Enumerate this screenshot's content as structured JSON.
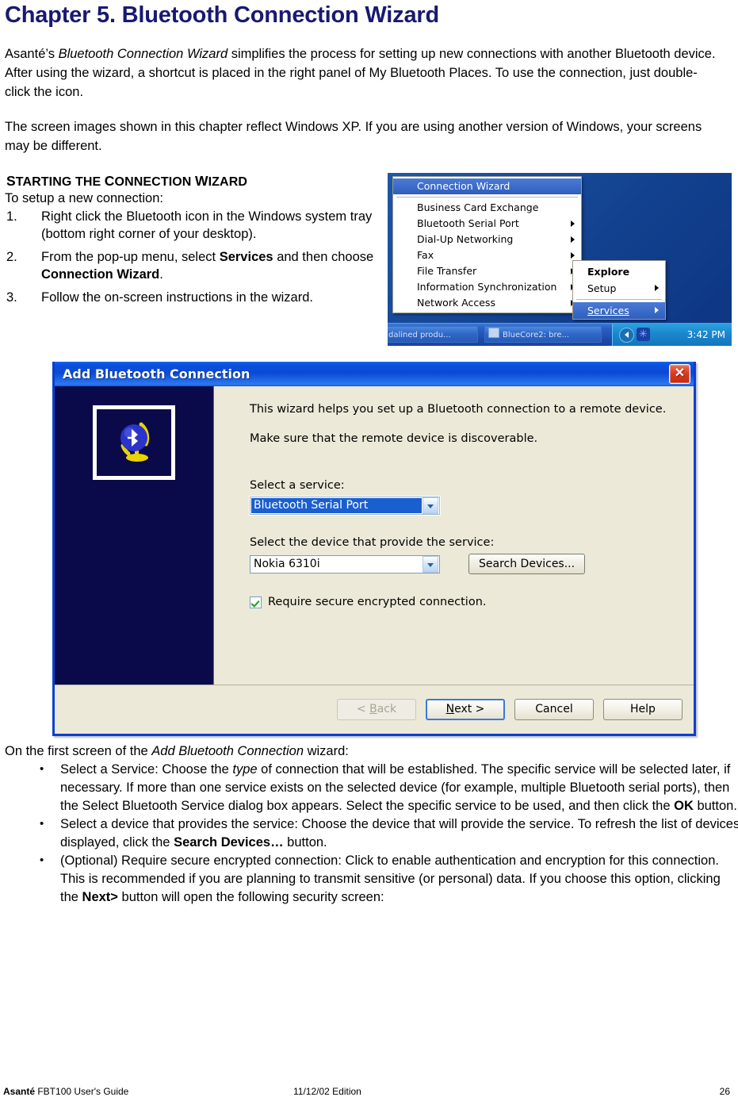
{
  "document": {
    "chapter_title": "Chapter 5. Bluetooth Connection Wizard",
    "paragraph_1_a": "Asanté’s ",
    "paragraph_1_em": "Bluetooth Connection Wizard",
    "paragraph_1_b": " simplifies the process for setting up new connections with another Bluetooth device. After using the wizard, a shortcut is placed in the right panel of My Bluetooth Places. To use the connection, just double-click the icon.",
    "paragraph_2": "The screen images shown in this chapter reflect Windows XP. If you are using another version of Windows, your screens may be different."
  },
  "section": {
    "heading_parts": [
      "S",
      "TARTING THE ",
      "C",
      "ONNECTION ",
      "W",
      "IZARD"
    ],
    "heading_text": "STARTING THE CONNECTION WIZARD",
    "intro": "To setup a new connection:",
    "steps": [
      {
        "num": "1.",
        "text": "Right click the Bluetooth icon in the Windows system tray (bottom right corner of your desktop)."
      },
      {
        "num": "2.",
        "pre": "From the pop-up menu, select ",
        "bold1": "Services",
        "mid": " and then choose ",
        "bold2": "Connection Wizard",
        "post": "."
      },
      {
        "num": "3.",
        "text": "Follow the on-screen instructions in the wizard."
      }
    ]
  },
  "tray_screenshot": {
    "context_menu": {
      "selected_item": "Connection Wizard",
      "items": [
        {
          "label": "Business Card Exchange",
          "submenu": false
        },
        {
          "label": "Bluetooth Serial Port",
          "submenu": true
        },
        {
          "label": "Dial-Up Networking",
          "submenu": true
        },
        {
          "label": "Fax",
          "submenu": true
        },
        {
          "label": "File Transfer",
          "submenu": true
        },
        {
          "label": "Information Synchronization",
          "submenu": true
        },
        {
          "label": "Network Access",
          "submenu": true
        }
      ]
    },
    "sub_menu": {
      "items": [
        {
          "label": "Explore",
          "bold": true,
          "submenu": false,
          "selected": false
        },
        {
          "label": "Setup",
          "bold": false,
          "submenu": true,
          "selected": false
        },
        {
          "label": "Services",
          "bold": false,
          "submenu": true,
          "selected": true
        }
      ]
    },
    "taskbar": {
      "button_1": "dalined produ...",
      "button_2": "BlueCore2: bre...",
      "clock": "3:42 PM"
    },
    "colors": {
      "menu_highlight": "#3465c4",
      "desktop": "#12418e",
      "taskbar": "#2b62c4"
    }
  },
  "wizard_dialog": {
    "title": "Add Bluetooth Connection",
    "close_label": "✕",
    "intro_line_1": "This wizard helps you set up a Bluetooth connection to a remote device.",
    "intro_line_2": "Make sure that the remote device is discoverable.",
    "service_label": "Select a service:",
    "service_value": "Bluetooth Serial Port",
    "device_label": "Select the device that provide the service:",
    "device_value": "Nokia 6310i",
    "search_button": "Search Devices...",
    "checkbox_label": "Require secure encrypted connection.",
    "checkbox_checked": true,
    "buttons": {
      "back": "< Back",
      "back_accel": "B",
      "next": "Next >",
      "next_accel": "N",
      "cancel": "Cancel",
      "help": "Help"
    },
    "colors": {
      "title_bar": "#0b49d4",
      "face": "#ece9d8",
      "sidebar": "#0a0a4a",
      "selection": "#1a5fd0"
    },
    "icon_name": "bluetooth-globe-icon"
  },
  "bullets": {
    "lead_a": "On the first screen of the ",
    "lead_em": "Add Bluetooth Connection",
    "lead_b": " wizard:",
    "items": [
      {
        "p1": "Select a Service: Choose the ",
        "em": "type",
        "p2": " of connection that will be established. The specific service will be selected later, if necessary. If more than one service exists on the selected device (for example, multiple Bluetooth serial ports), then the Select Bluetooth Service dialog box appears. Select the specific service to be used, and then click the ",
        "bold": "OK",
        "p3": " button."
      },
      {
        "p1": "Select a device that provides the service: Choose the device that will provide the service. To refresh the list of devices displayed, click the ",
        "bold": "Search Devices…",
        "p3": " button."
      },
      {
        "p1": "(Optional) Require secure encrypted connection: Click to enable authentication and encryption for this connection. This is recommended if you are planning to transmit sensitive (or personal) data. If you choose this option, clicking the ",
        "bold": "Next>",
        "p3": " button will open the following security screen:"
      }
    ]
  },
  "footer": {
    "left_bold": "Asanté",
    "left_rest": " FBT100 User's Guide",
    "center": "11/12/02 Edition",
    "page_number": "26"
  }
}
